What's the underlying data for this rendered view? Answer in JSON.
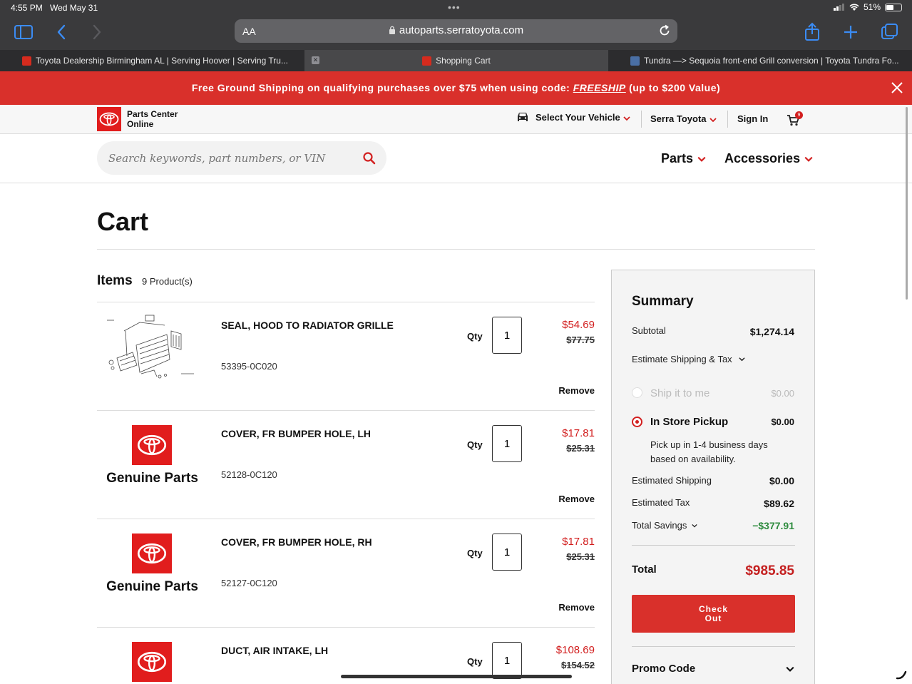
{
  "status_bar": {
    "time": "4:55 PM",
    "date": "Wed May 31",
    "battery": "51%",
    "battery_level": 0.51
  },
  "browser": {
    "text_size_label": "AA",
    "url": "autoparts.serratoyota.com",
    "tabs": [
      {
        "title": "Toyota Dealership Birmingham AL | Serving Hoover | Serving Tru...",
        "active": false
      },
      {
        "title": "Shopping Cart",
        "active": true
      },
      {
        "title": "Tundra —> Sequoia front-end Grill conversion | Toyota Tundra Fo...",
        "active": false
      }
    ]
  },
  "promo": {
    "text_before": "Free Ground Shipping on qualifying purchases over $75 when using code: ",
    "code": "FREESHIP",
    "text_after": " (up to $200 Value)"
  },
  "header": {
    "logo_line1": "Parts Center",
    "logo_line2": "Online",
    "select_vehicle": "Select Your Vehicle",
    "dealer": "Serra Toyota",
    "sign_in": "Sign In",
    "cart_count": "9"
  },
  "search": {
    "placeholder": "Search keywords, part numbers, or VIN"
  },
  "nav": {
    "parts": "Parts",
    "accessories": "Accessories"
  },
  "page": {
    "title": "Cart",
    "items_label": "Items",
    "items_count": "9 Product(s)"
  },
  "cart_items": [
    {
      "name": "SEAL, HOOD TO RADIATOR GRILLE",
      "part_number": "53395-0C020",
      "qty_label": "Qty",
      "qty": "1",
      "price": "$54.69",
      "was_price": "$77.75",
      "remove": "Remove",
      "image": "diagram"
    },
    {
      "name": "COVER, FR BUMPER HOLE, LH",
      "part_number": "52128-0C120",
      "qty_label": "Qty",
      "qty": "1",
      "price": "$17.81",
      "was_price": "$25.31",
      "remove": "Remove",
      "image": "genuine",
      "image_label": "Genuine Parts"
    },
    {
      "name": "COVER, FR BUMPER HOLE, RH",
      "part_number": "52127-0C120",
      "qty_label": "Qty",
      "qty": "1",
      "price": "$17.81",
      "was_price": "$25.31",
      "remove": "Remove",
      "image": "genuine",
      "image_label": "Genuine Parts"
    },
    {
      "name": "DUCT, AIR INTAKE, LH",
      "part_number": "",
      "qty_label": "Qty",
      "qty": "1",
      "price": "$108.69",
      "was_price": "$154.52",
      "remove": "",
      "image": "genuine",
      "image_label": ""
    }
  ],
  "summary": {
    "title": "Summary",
    "subtotal_label": "Subtotal",
    "subtotal": "$1,274.14",
    "estimate_label": "Estimate Shipping & Tax",
    "ship_label": "Ship it to me",
    "ship_value": "$0.00",
    "pickup_label": "In Store Pickup",
    "pickup_value": "$0.00",
    "pickup_note_1": "Pick up in 1-4 business days",
    "pickup_note_2": "based on availability.",
    "est_shipping_label": "Estimated Shipping",
    "est_shipping": "$0.00",
    "est_tax_label": "Estimated Tax",
    "est_tax": "$89.62",
    "savings_label": "Total Savings",
    "savings": "−$377.91",
    "total_label": "Total",
    "total": "$985.85",
    "checkout_line1": "Check",
    "checkout_line2": "Out",
    "promo_label": "Promo Code"
  },
  "colors": {
    "brand_red": "#d9302b",
    "price_red": "#d21f1f",
    "savings_green": "#2e8b3e",
    "link_blue": "#3b8cf5"
  }
}
